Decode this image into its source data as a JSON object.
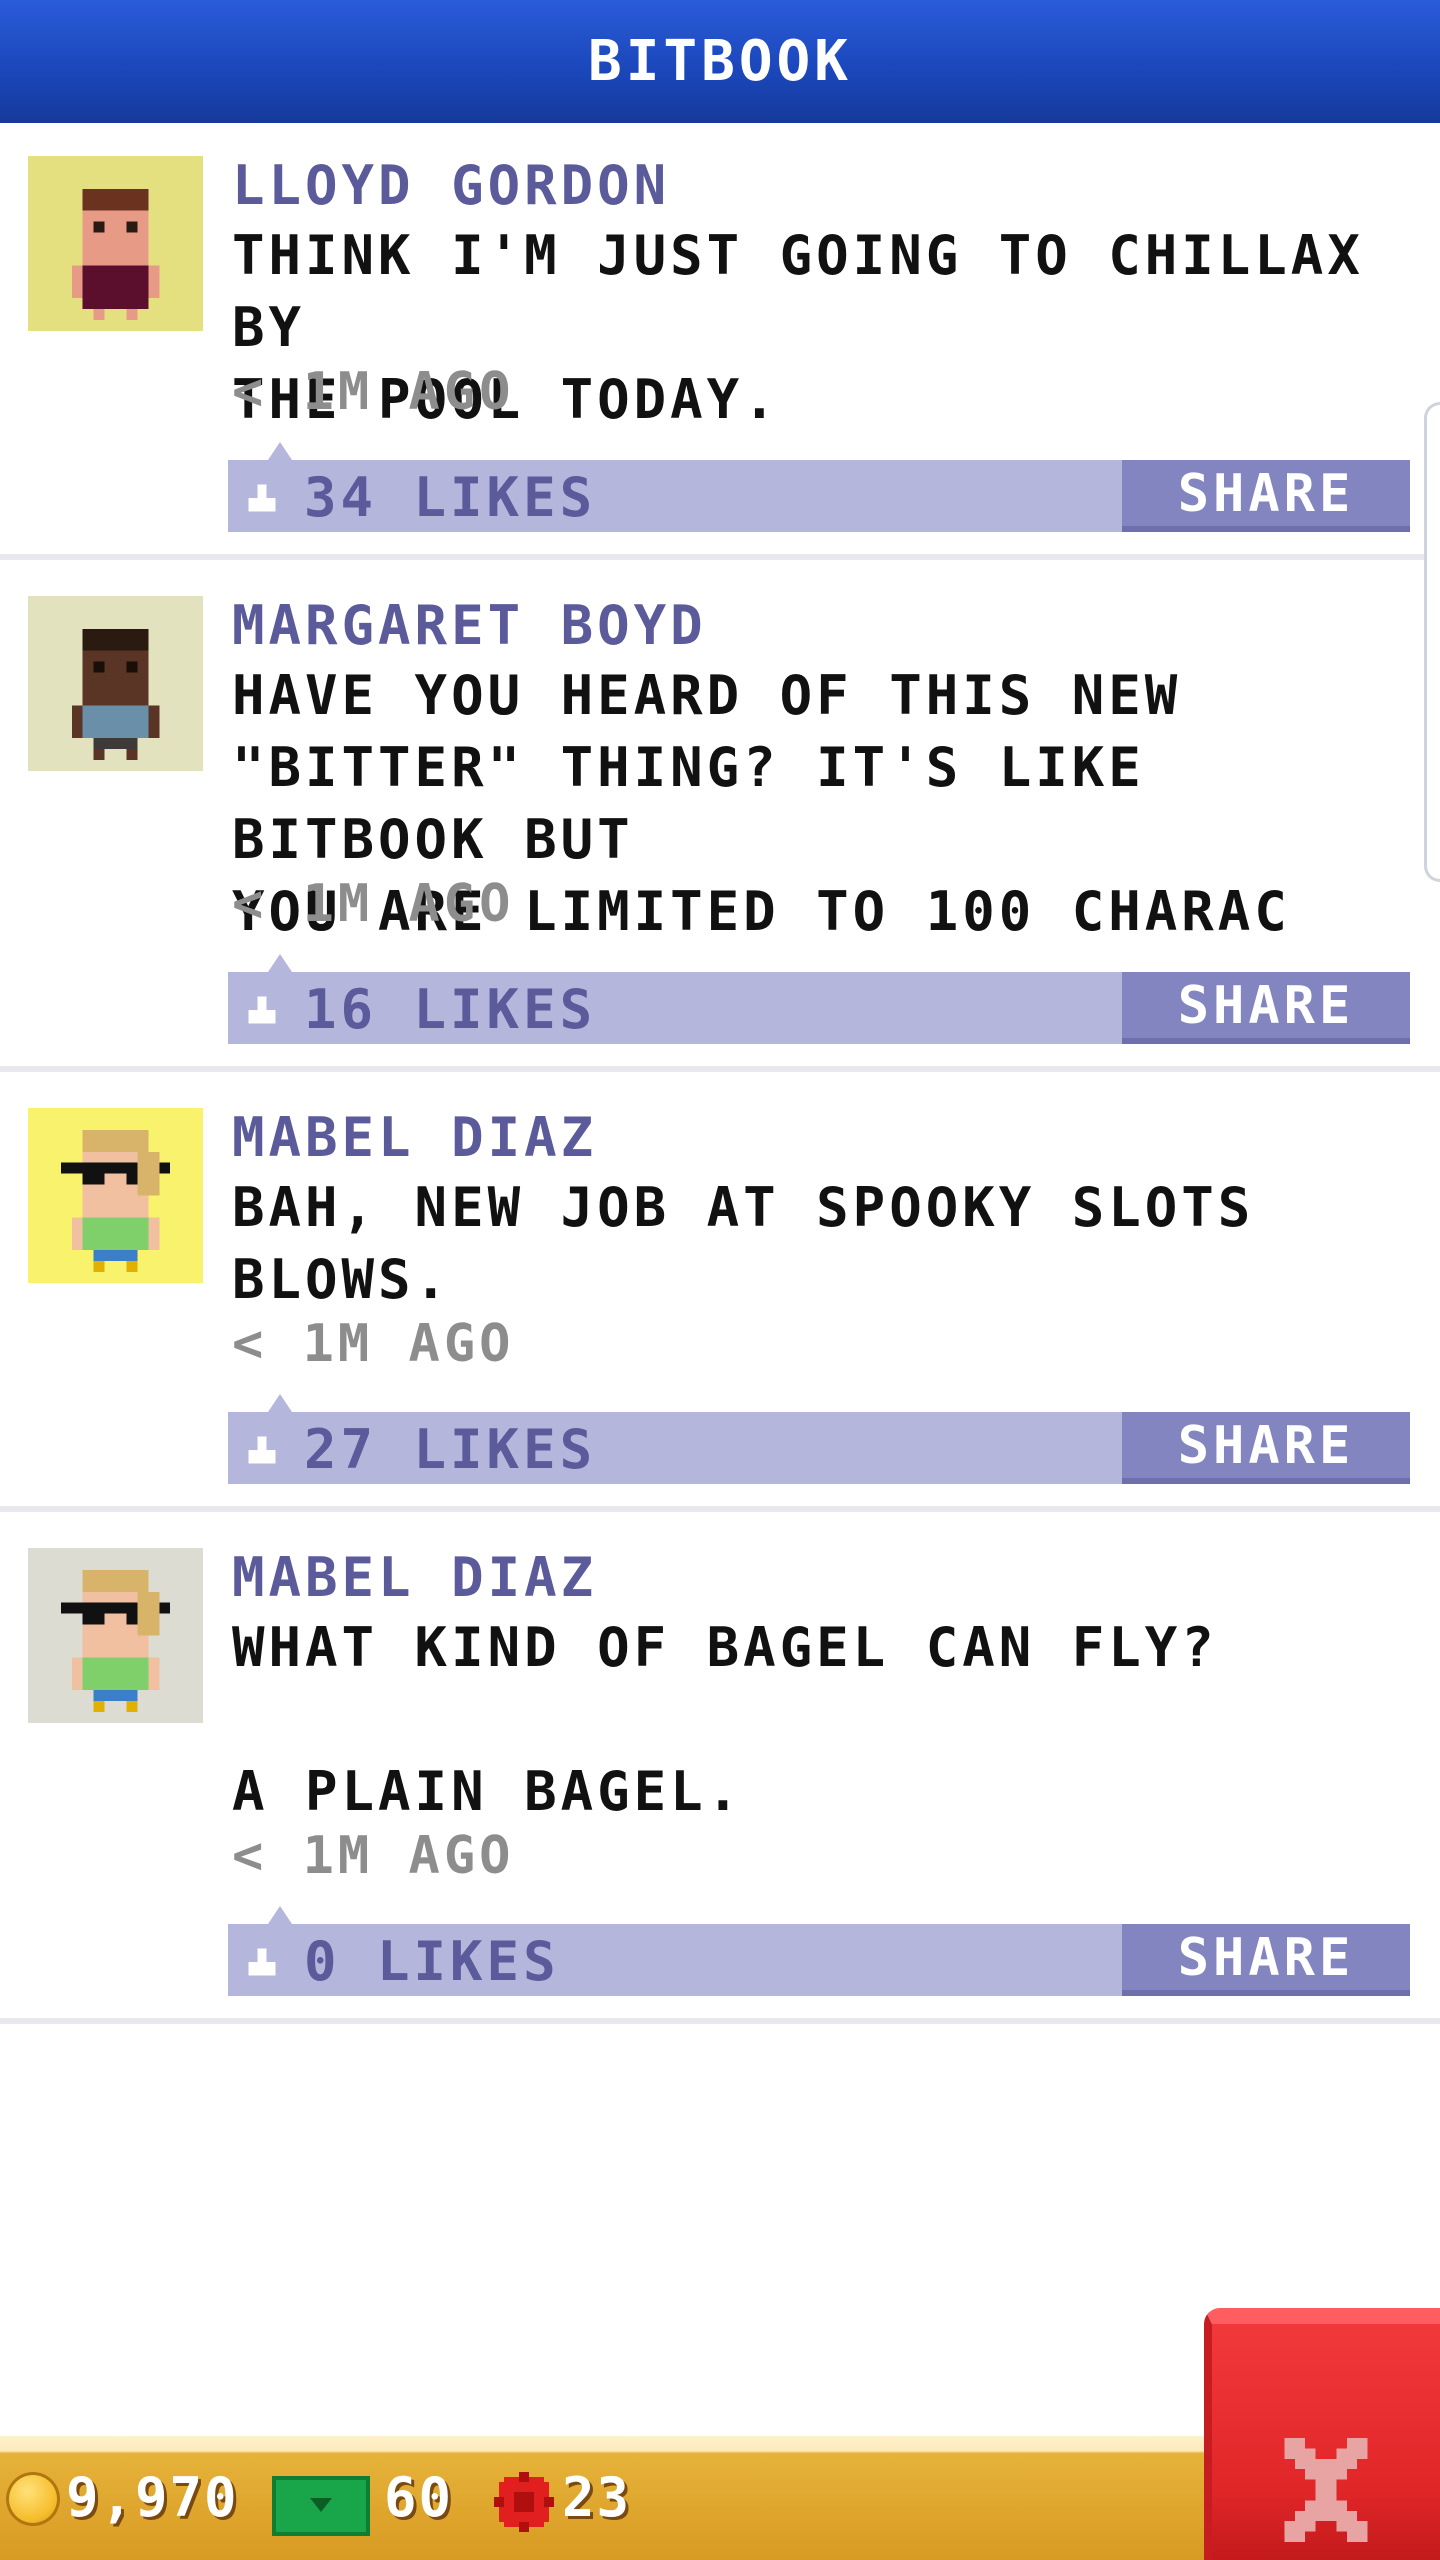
{
  "header": {
    "title": "BITBOOK"
  },
  "posts": [
    {
      "name": "LLOYD GORDON",
      "message": "THINK I'M JUST GOING TO CHILLAX BY\nTHE POOL TODAY.",
      "time": "< 1M AGO",
      "likes": "34 LIKES",
      "share": "SHARE",
      "avatar_bg": "#e4e07f"
    },
    {
      "name": "MARGARET BOYD",
      "message": "HAVE YOU HEARD OF THIS NEW\n\"BITTER\" THING? IT'S LIKE BITBOOK BUT\nYOU ARE LIMITED TO 100 CHARAC",
      "time": "< 1M AGO",
      "likes": "16 LIKES",
      "share": "SHARE",
      "avatar_bg": "#e3e2bf"
    },
    {
      "name": "MABEL DIAZ",
      "message": "BAH, NEW JOB AT SPOOKY SLOTS\nBLOWS.",
      "time": "< 1M AGO",
      "likes": "27 LIKES",
      "share": "SHARE",
      "avatar_bg": "#f8f26c"
    },
    {
      "name": "MABEL DIAZ",
      "message": "WHAT KIND OF BAGEL CAN FLY?\n\nA PLAIN BAGEL.",
      "time": "< 1M AGO",
      "likes": "0 LIKES",
      "share": "SHARE",
      "avatar_bg": "#dddcd3"
    }
  ],
  "status": {
    "coins": "9,970",
    "cash": "60",
    "chips": "23"
  },
  "colors": {
    "header": "#1a46b9",
    "like_bar": "#b4b6db",
    "share_button": "#8385c0",
    "name_text": "#5b5a9a",
    "close_button": "#e12628"
  },
  "icons": {
    "close": "close-x-icon",
    "coin": "coin-icon",
    "cash": "cash-icon",
    "chip": "chip-icon",
    "like": "thumbs-up-icon"
  }
}
